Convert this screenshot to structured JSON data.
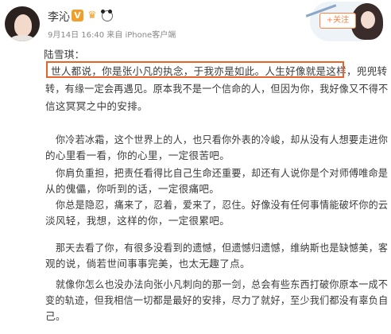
{
  "post": {
    "username": "李沁",
    "badge_v": "V",
    "meta": "9月14日 16:40 来自 iPhone客户端",
    "follow_button": "+关注",
    "lines": [
      "陆雪琪：",
      "世人都说，你是张小凡的执念，于我亦是如此。人生好像就是这样，兜兜转",
      "转，有缘一定会再遇见。原本我不是一个信命的人，但因为你，我好像又不得不",
      "信这冥冥之中的安排。",
      "你冷若冰霜，这个世界上的人，也只看你外表的冷峻，却从没有人想要走进你",
      "的心里看一看，你的心里，一定很苦吧。",
      "你肩负重担，把责任看得比自己生命还重要，却还有人说你是个对师傅唯命是",
      "从的傀儡，你听到的话，一定很痛吧。",
      "你总是隐忍，痛来了，忍着，爱来了，忍住。好像没有任何事情能破坏你的云",
      "淡风轻，我想，这样的你，一定很累吧。",
      "那天去看了你，有很多没看到的遗憾，但遗憾归遗憾，维纳斯也是缺憾美，客",
      "观的说，倘若世间事事完美，也太无趣了点。",
      "就像你怎么也没办法向张小凡刺向的那一剑，总会有些东西打破你原本一成不",
      "变的轨迹，但我相信一切都是最好的安排，尽力了就好，至少我们都没有辜负自",
      "己。"
    ]
  },
  "colors": {
    "highlight_border": "#e8632a",
    "follow": "#ff8140",
    "meta_text": "#888888",
    "badge": "#f0a02a"
  },
  "icons": [
    "avatar-photo",
    "verified-v-icon",
    "crown-icon",
    "panda-icon",
    "profile-decoration-girl"
  ]
}
